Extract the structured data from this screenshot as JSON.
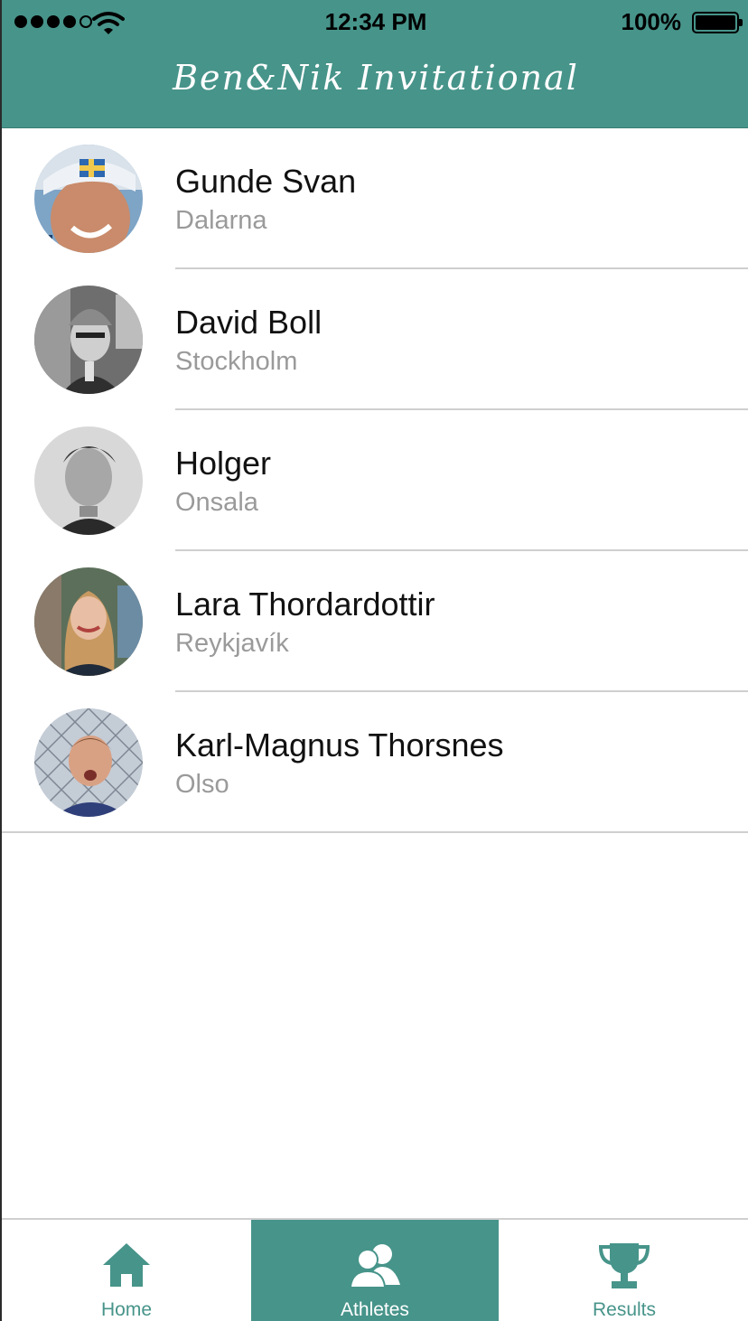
{
  "status_bar": {
    "time": "12:34 PM",
    "battery_percent": "100%",
    "signal_bars_filled": 4,
    "signal_bars_total": 5
  },
  "nav": {
    "title": "Ben&Nik Invitational"
  },
  "athletes": [
    {
      "name": "Gunde Svan",
      "city": "Dalarna"
    },
    {
      "name": "David Boll",
      "city": "Stockholm"
    },
    {
      "name": "Holger",
      "city": "Onsala"
    },
    {
      "name": "Lara Thordardottir",
      "city": "Reykjavík"
    },
    {
      "name": "Karl-Magnus Thorsnes",
      "city": "Olso"
    }
  ],
  "tabs": [
    {
      "label": "Home",
      "icon": "home-icon",
      "active": false
    },
    {
      "label": "Athletes",
      "icon": "users-icon",
      "active": true
    },
    {
      "label": "Results",
      "icon": "trophy-icon",
      "active": false
    }
  ],
  "colors": {
    "accent": "#47948a",
    "secondary_text": "#9a9a9a",
    "separator": "#cfcfcf"
  }
}
